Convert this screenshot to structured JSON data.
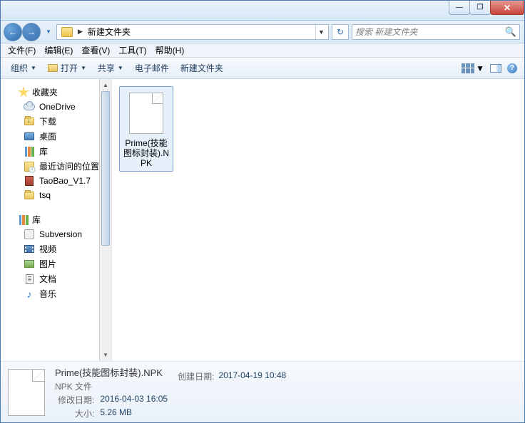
{
  "titlebar": {
    "min": "—",
    "max": "❐",
    "close": "✕"
  },
  "nav": {
    "back": "←",
    "fwd": "→"
  },
  "address": {
    "crumb": "新建文件夹"
  },
  "search": {
    "placeholder": "搜索 新建文件夹"
  },
  "menu": {
    "file": "文件(F)",
    "edit": "编辑(E)",
    "view": "查看(V)",
    "tools": "工具(T)",
    "help": "帮助(H)"
  },
  "toolbar": {
    "organize": "组织",
    "open": "打开",
    "share": "共享",
    "email": "电子邮件",
    "newfolder": "新建文件夹"
  },
  "sidebar": {
    "favorites": {
      "label": "收藏夹",
      "items": [
        {
          "label": "OneDrive"
        },
        {
          "label": "下载"
        },
        {
          "label": "桌面"
        },
        {
          "label": "库"
        },
        {
          "label": "最近访问的位置"
        },
        {
          "label": "TaoBao_V1.7"
        },
        {
          "label": "tsq"
        }
      ]
    },
    "libraries": {
      "label": "库",
      "items": [
        {
          "label": "Subversion"
        },
        {
          "label": "视频"
        },
        {
          "label": "图片"
        },
        {
          "label": "文档"
        },
        {
          "label": "音乐"
        }
      ]
    }
  },
  "files": [
    {
      "name": "Prime(技能图标封装).NPK"
    }
  ],
  "details": {
    "name": "Prime(技能图标封装).NPK",
    "type": "NPK 文件",
    "created_k": "创建日期:",
    "created_v": "2017-04-19 10:48",
    "modified_k": "修改日期:",
    "modified_v": "2016-04-03 16:05",
    "size_k": "大小:",
    "size_v": "5.26 MB"
  }
}
